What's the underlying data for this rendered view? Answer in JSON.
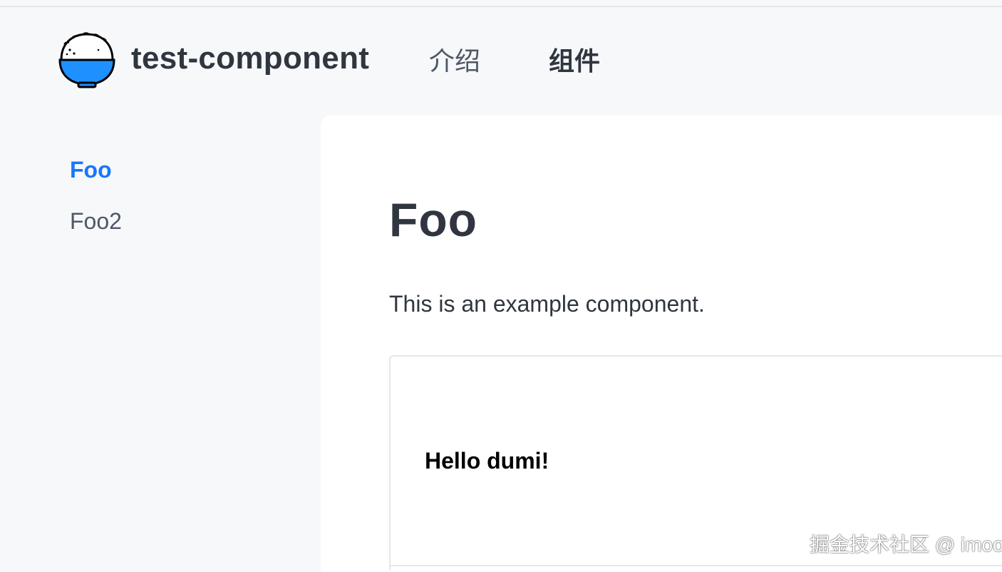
{
  "header": {
    "site_title": "test-component",
    "logo_icon": "rice-bowl-logo-icon",
    "nav": [
      {
        "label": "介绍",
        "active": false
      },
      {
        "label": "组件",
        "active": true
      }
    ]
  },
  "sidebar": {
    "items": [
      {
        "label": "Foo",
        "active": true
      },
      {
        "label": "Foo2",
        "active": false
      }
    ]
  },
  "main": {
    "title": "Foo",
    "description": "This is an example component.",
    "demo": {
      "output_text": "Hello dumi!"
    }
  },
  "watermark": "掘金技术社区 @ imoo",
  "colors": {
    "accent": "#1677ff",
    "text": "#30363f",
    "muted": "#4f5866",
    "background": "#f6f8fa"
  }
}
